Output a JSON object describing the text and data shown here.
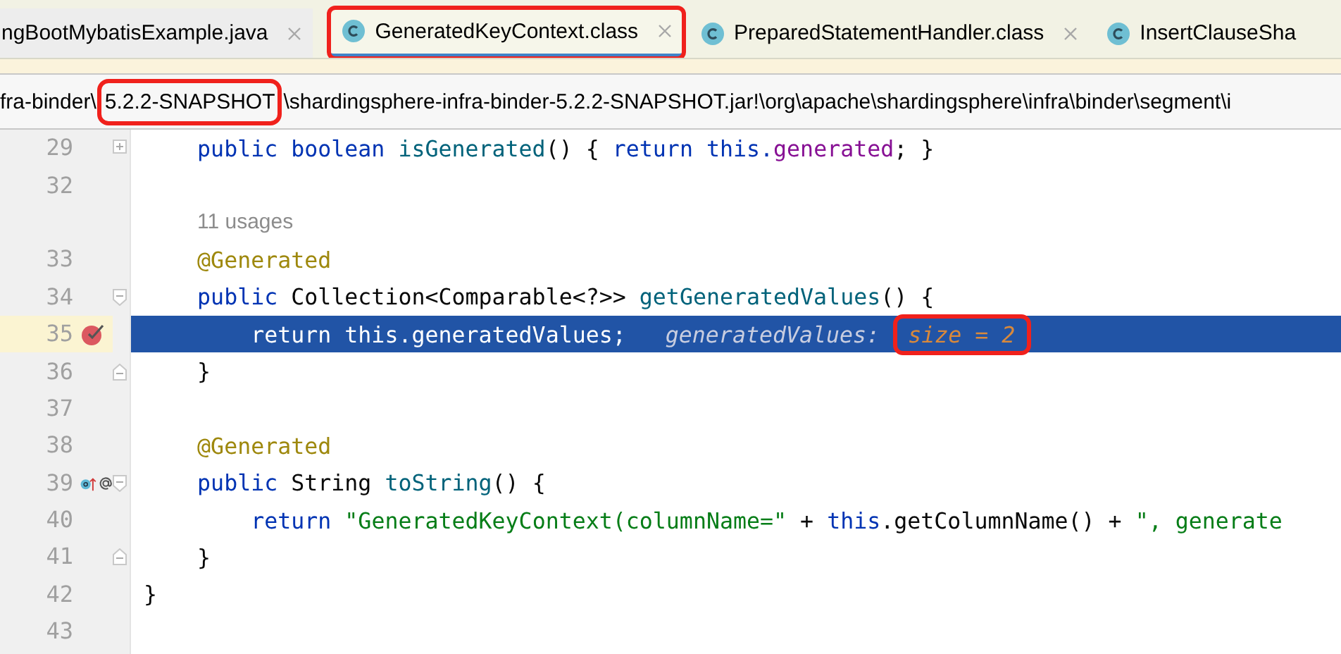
{
  "tabs": [
    {
      "label": "ngBootMybatisExample.java",
      "selected": false,
      "highlighted": false
    },
    {
      "label": "GeneratedKeyContext.class",
      "selected": true,
      "highlighted": true
    },
    {
      "label": "PreparedStatementHandler.class",
      "selected": false,
      "highlighted": false
    },
    {
      "label": "InsertClauseSha",
      "selected": false,
      "highlighted": false
    }
  ],
  "path": [
    {
      "text": "fra-binder\\",
      "highlighted": false
    },
    {
      "text": "5.2.2-SNAPSHOT",
      "highlighted": true
    },
    {
      "text": "\\shardingsphere-infra-binder-5.2.2-SNAPSHOT.jar!\\org\\apache\\shardingsphere\\infra\\binder\\segment\\i",
      "highlighted": false
    }
  ],
  "lines": [
    {
      "kind": "code",
      "number": "29",
      "folded": true,
      "selected": false,
      "tokens": [
        {
          "text": "    public boolean ",
          "kind": "keyword"
        },
        {
          "text": "isGenerated",
          "kind": "method"
        },
        {
          "text": "() { ",
          "kind": "plain"
        },
        {
          "text": "return this.",
          "kind": "keyword"
        },
        {
          "text": "generated",
          "kind": "field"
        },
        {
          "text": "; }",
          "kind": "plain"
        }
      ]
    },
    {
      "kind": "code",
      "number": "32",
      "selected": false
    },
    {
      "kind": "hint",
      "text": "11 usages"
    },
    {
      "kind": "code",
      "number": "33",
      "selected": false,
      "tokens": [
        {
          "text": "    @Generated",
          "kind": "annotation"
        }
      ]
    },
    {
      "kind": "code",
      "number": "34",
      "fold_start": true,
      "selected": false,
      "tokens": [
        {
          "text": "    public",
          "kind": "keyword"
        },
        {
          "text": " Collection<Comparable<?>> ",
          "kind": "plain"
        },
        {
          "text": "getGeneratedValues",
          "kind": "method"
        },
        {
          "text": "() {",
          "kind": "plain"
        }
      ]
    },
    {
      "kind": "code",
      "number": "35",
      "selected": true,
      "breakpoint": true,
      "tokens": [
        {
          "text": "        return this.generatedValues;",
          "kind": "plain"
        }
      ],
      "inline_hint": {
        "name": "generatedValues:",
        "value": "size = 2",
        "highlighted": true
      }
    },
    {
      "kind": "code",
      "number": "36",
      "fold_end": true,
      "selected": false,
      "tokens": [
        {
          "text": "    }",
          "kind": "plain"
        }
      ]
    },
    {
      "kind": "code",
      "number": "37",
      "selected": false
    },
    {
      "kind": "code",
      "number": "38",
      "selected": false,
      "tokens": [
        {
          "text": "    @Generated",
          "kind": "annotation"
        }
      ]
    },
    {
      "kind": "code",
      "number": "39",
      "fold_start": true,
      "overrides": true,
      "selected": false,
      "tokens": [
        {
          "text": "    public",
          "kind": "keyword"
        },
        {
          "text": " String ",
          "kind": "plain"
        },
        {
          "text": "toString",
          "kind": "method"
        },
        {
          "text": "() {",
          "kind": "plain"
        }
      ]
    },
    {
      "kind": "code",
      "number": "40",
      "selected": false,
      "tokens": [
        {
          "text": "        return ",
          "kind": "keyword"
        },
        {
          "text": "\"GeneratedKeyContext(columnName=\"",
          "kind": "string"
        },
        {
          "text": " + ",
          "kind": "plain"
        },
        {
          "text": "this",
          "kind": "keyword"
        },
        {
          "text": ".getColumnName() + ",
          "kind": "plain"
        },
        {
          "text": "\", generate",
          "kind": "string"
        }
      ]
    },
    {
      "kind": "code",
      "number": "41",
      "fold_end": true,
      "selected": false,
      "tokens": [
        {
          "text": "    }",
          "kind": "plain"
        }
      ]
    },
    {
      "kind": "code",
      "number": "42",
      "selected": false,
      "tokens": [
        {
          "text": "}",
          "kind": "plain"
        }
      ]
    },
    {
      "kind": "code",
      "number": "43",
      "selected": false
    }
  ]
}
